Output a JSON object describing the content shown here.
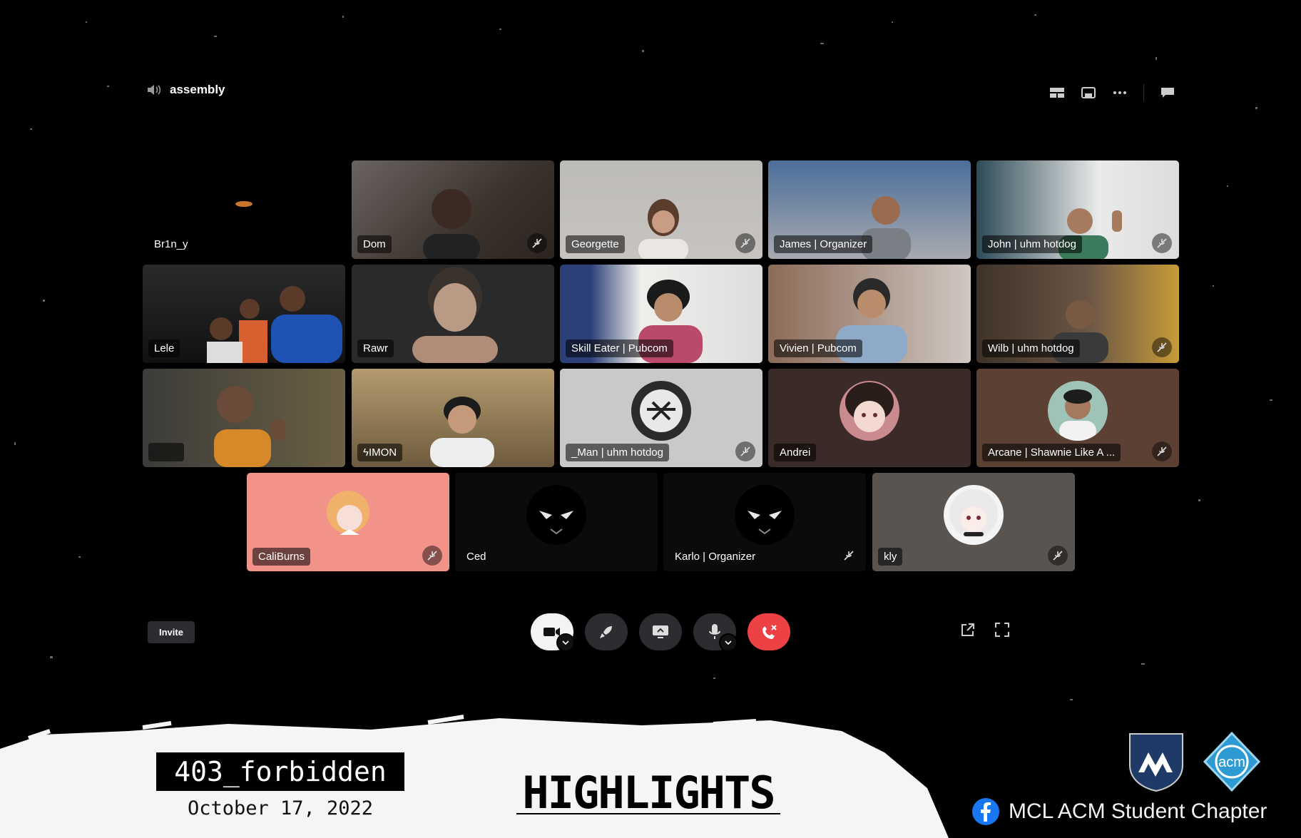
{
  "channel": {
    "name": "assembly",
    "icon": "speaker-icon"
  },
  "participants": [
    {
      "name": "Br1n_y",
      "muted": false
    },
    {
      "name": "Dom",
      "muted": true
    },
    {
      "name": "Georgette",
      "muted": true
    },
    {
      "name": "James | Organizer",
      "muted": false
    },
    {
      "name": "John | uhm hotdog",
      "muted": true
    },
    {
      "name": "Lele",
      "muted": false
    },
    {
      "name": "Rawr",
      "muted": false
    },
    {
      "name": "Skill Eater | Pubcom",
      "muted": false
    },
    {
      "name": "Vivien | Pubcom",
      "muted": false
    },
    {
      "name": "Wilb | uhm hotdog",
      "muted": true
    },
    {
      "name": "",
      "muted": false
    },
    {
      "name": "ϟIMON",
      "muted": false
    },
    {
      "name": "_Man | uhm hotdog",
      "muted": true
    },
    {
      "name": "Andrei",
      "muted": false
    },
    {
      "name": "Arcane | Shawnie Like A ...",
      "muted": true
    },
    {
      "name": "CaliBurns",
      "muted": true
    },
    {
      "name": "Ced",
      "muted": false
    },
    {
      "name": "Karlo | Organizer",
      "muted": true
    },
    {
      "name": "kly",
      "muted": true
    }
  ],
  "controls": {
    "invite_label": "Invite"
  },
  "banner": {
    "event_name": "403_forbidden",
    "event_date": "October 17, 2022",
    "highlights": "HIGHLIGHTS",
    "org_name": "MCL ACM Student Chapter",
    "acm_logo_text": "acm"
  },
  "colors": {
    "end_call": "#ed4245",
    "caliburns_bg": "#f2938a",
    "kly_bg": "#5a5450",
    "andrei_bg": "#3b2b28",
    "arcane_bg": "#5c4034",
    "man_bg": "#c9c9c9"
  }
}
